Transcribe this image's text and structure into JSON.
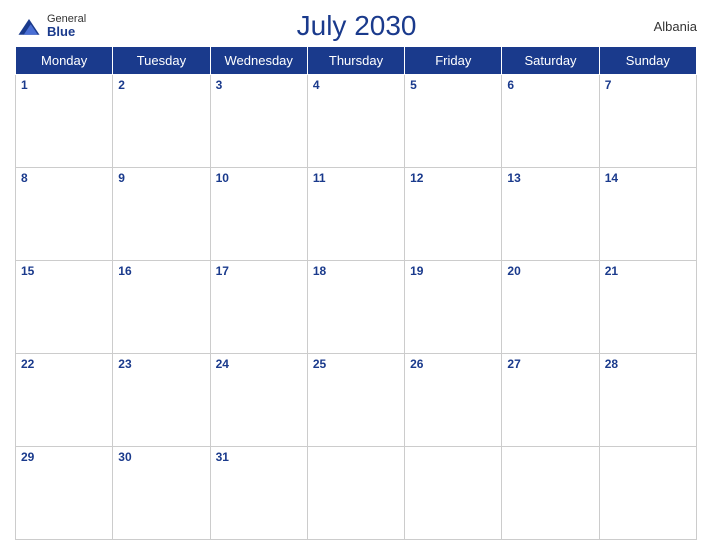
{
  "header": {
    "logo_general": "General",
    "logo_blue": "Blue",
    "title": "July 2030",
    "country": "Albania"
  },
  "weekdays": [
    "Monday",
    "Tuesday",
    "Wednesday",
    "Thursday",
    "Friday",
    "Saturday",
    "Sunday"
  ],
  "weeks": [
    [
      1,
      2,
      3,
      4,
      5,
      6,
      7
    ],
    [
      8,
      9,
      10,
      11,
      12,
      13,
      14
    ],
    [
      15,
      16,
      17,
      18,
      19,
      20,
      21
    ],
    [
      22,
      23,
      24,
      25,
      26,
      27,
      28
    ],
    [
      29,
      30,
      31,
      null,
      null,
      null,
      null
    ]
  ]
}
